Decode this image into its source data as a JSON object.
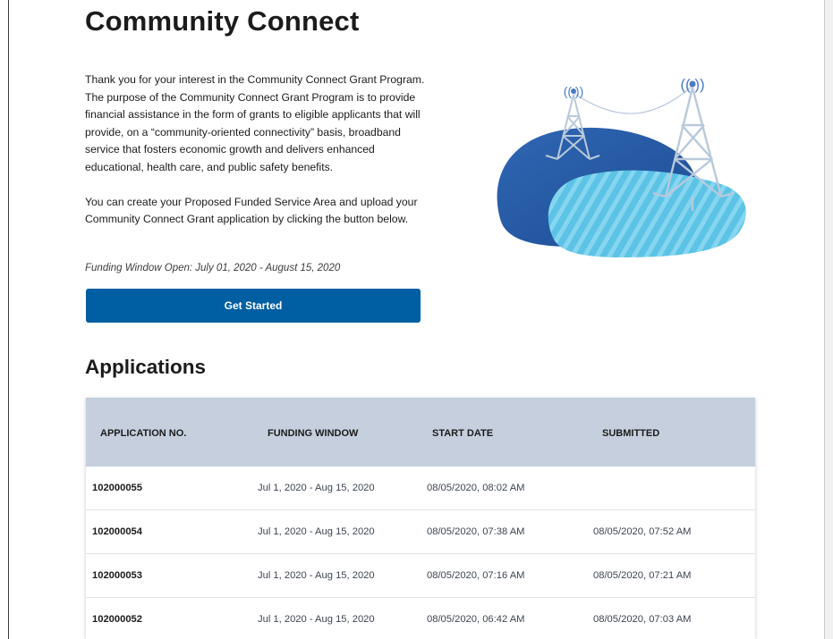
{
  "page": {
    "title": "Community Connect",
    "intro_paragraphs": [
      "Thank you for your interest in the Community Connect Grant Program. The purpose of the Community Connect Grant Program is to provide financial assistance in the form of grants to eligible applicants that will provide, on a “community-oriented connectivity” basis, broadband service that fosters economic growth and delivers enhanced educational, health care, and public safety benefits.",
      "You can create your Proposed Funded Service Area and upload your Community Connect Grant application by clicking the button below."
    ],
    "funding_window_text": "Funding Window Open: July 01, 2020 - August 15, 2020",
    "get_started_label": "Get Started",
    "hero_icon": "broadband-towers-illustration"
  },
  "applications": {
    "heading": "Applications",
    "columns": [
      "APPLICATION NO.",
      "FUNDING WINDOW",
      "START DATE",
      "SUBMITTED"
    ],
    "rows": [
      {
        "number": "102000055",
        "funding_window": "Jul 1, 2020 - Aug 15, 2020",
        "start_date": "08/05/2020, 08:02 AM",
        "submitted": ""
      },
      {
        "number": "102000054",
        "funding_window": "Jul 1, 2020 - Aug 15, 2020",
        "start_date": "08/05/2020, 07:38 AM",
        "submitted": "08/05/2020, 07:52 AM"
      },
      {
        "number": "102000053",
        "funding_window": "Jul 1, 2020 - Aug 15, 2020",
        "start_date": "08/05/2020, 07:16 AM",
        "submitted": "08/05/2020, 07:21 AM"
      },
      {
        "number": "102000052",
        "funding_window": "Jul 1, 2020 - Aug 15, 2020",
        "start_date": "08/05/2020, 06:42 AM",
        "submitted": "08/05/2020, 07:03 AM"
      }
    ]
  },
  "colors": {
    "primary_button": "#005ea2",
    "table_header": "#c5cfdd",
    "hero_dark_blue": "#2f5fa8",
    "hero_light_blue": "#5cc3e6"
  }
}
